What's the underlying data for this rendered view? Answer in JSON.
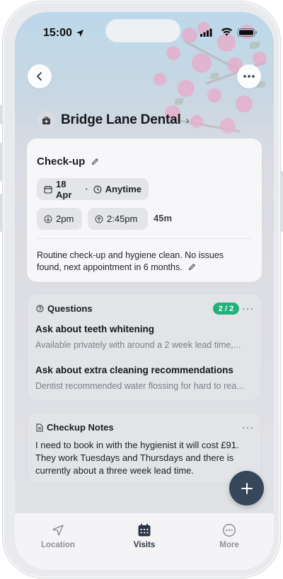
{
  "status_bar": {
    "time": "15:00"
  },
  "header": {
    "title": "Bridge Lane Dental"
  },
  "visit": {
    "title": "Check-up",
    "date": "18 Apr",
    "time_window": "Anytime",
    "start": "2pm",
    "end": "2:45pm",
    "duration": "45m",
    "notes": "Routine check-up and hygiene clean. No issues found, next appointment in 6 months."
  },
  "questions": {
    "heading": "Questions",
    "count": "2 / 2",
    "items": [
      {
        "title": "Ask about teeth whitening",
        "answer": "Available privately with around a 2 week lead time,..."
      },
      {
        "title": "Ask about extra cleaning recommendations",
        "answer": "Dentist recommended water flossing for hard to rea..."
      }
    ]
  },
  "notes": {
    "heading": "Checkup Notes",
    "body": "I need to book in with the hygienist it will cost £91. They work Tuesdays and Thursdays and there is currently about a three week lead time."
  },
  "tabs": [
    {
      "label": "Location",
      "icon": "navigation-arrow-icon",
      "active": false
    },
    {
      "label": "Visits",
      "icon": "calendar-icon",
      "active": true
    },
    {
      "label": "More",
      "icon": "ellipsis-circle-icon",
      "active": false
    }
  ],
  "colors": {
    "accent": "#36465b",
    "badge_green": "#23b07a",
    "blossom_pink": "#e8a9c8"
  }
}
